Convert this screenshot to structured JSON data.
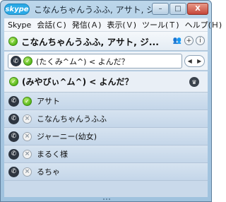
{
  "titlebar": {
    "app_logo": "skype",
    "title": "こなんちゃんうふふ, アサト, ジャ",
    "minimize": "–",
    "maximize": "□",
    "close": "X"
  },
  "menu": {
    "items": [
      {
        "label": "Skype"
      },
      {
        "label": "会話(Ｃ)"
      },
      {
        "label": "発信(Ａ)"
      },
      {
        "label": "表示(Ｖ)"
      },
      {
        "label": "ツール(Ｔ)"
      },
      {
        "label": "ヘルプ(Ｈ)"
      }
    ]
  },
  "chat_header": {
    "title": "こなんちゃんうふふ, アサト, ジ...",
    "icons": [
      "group-icon",
      "add-icon",
      "info-icon"
    ],
    "add_glyph": "+",
    "info_glyph": "i"
  },
  "input": {
    "text": "(たくみ^ム^) < よんだ？",
    "arrow_left": "◀",
    "arrow_right": "▶"
  },
  "group": {
    "label": "(みやびぃ^ム^) < よんだ？"
  },
  "contacts": [
    {
      "name": "アサト",
      "status": "online"
    },
    {
      "name": "こなんちゃんうふふ",
      "status": "offline"
    },
    {
      "name": "ジャーニー(幼女)",
      "status": "offline"
    },
    {
      "name": "まるく様",
      "status": "offline"
    },
    {
      "name": "るちゃ",
      "status": "offline"
    }
  ],
  "colors": {
    "online": "#57b81a",
    "skype_blue": "#2aa9e6",
    "frame": "#a9c8e2"
  }
}
